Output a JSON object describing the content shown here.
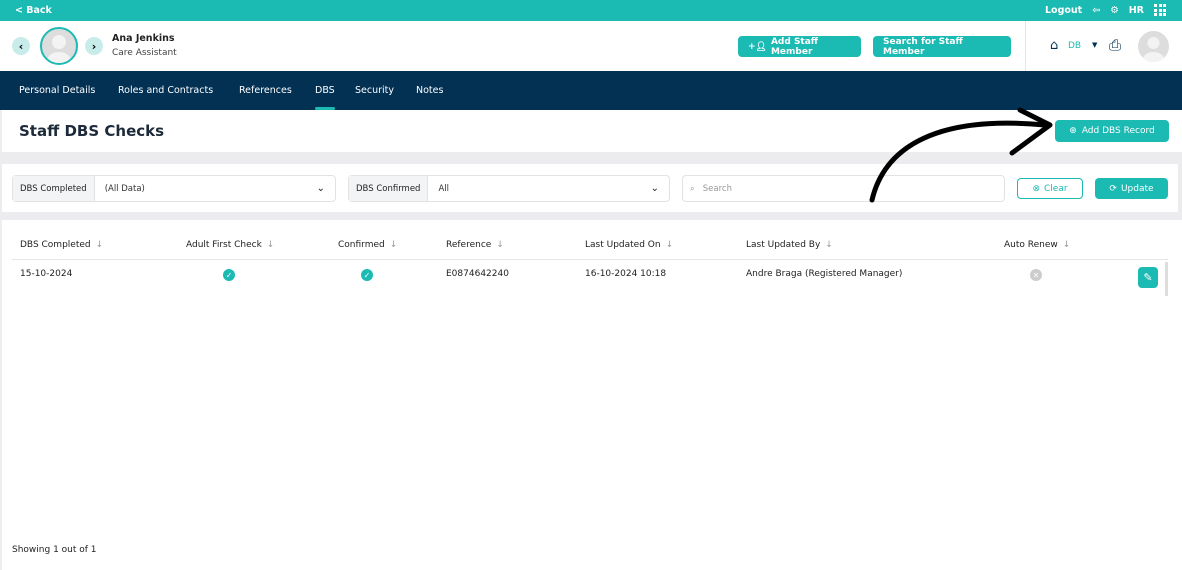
{
  "topbar": {
    "back": "< Back",
    "logout": "Logout",
    "initials": "HR"
  },
  "staff": {
    "name": "Ana Jenkins",
    "role": "Care Assistant"
  },
  "header": {
    "add_staff": "Add Staff Member",
    "search_staff": "Search for Staff Member",
    "home_label": "DB"
  },
  "nav": {
    "tabs": [
      "Personal Details",
      "Roles and Contracts",
      "References",
      "DBS",
      "Security",
      "Notes"
    ],
    "active": "DBS"
  },
  "page": {
    "title": "Staff DBS Checks",
    "add_button": "Add DBS Record"
  },
  "filters": {
    "dbs_completed_label": "DBS Completed",
    "dbs_completed_value": "(All Data)",
    "dbs_confirmed_label": "DBS Confirmed",
    "dbs_confirmed_value": "All",
    "search_placeholder": "Search",
    "clear": "Clear",
    "update": "Update"
  },
  "table": {
    "columns": [
      "DBS Completed",
      "Adult First Check",
      "Confirmed",
      "Reference",
      "Last Updated On",
      "Last Updated By",
      "Auto Renew"
    ],
    "rows": [
      {
        "dbs_completed": "15-10-2024",
        "adult_first_check": true,
        "confirmed": true,
        "reference": "E0874642240",
        "last_updated_on": "16-10-2024 10:18",
        "last_updated_by": "Andre Braga (Registered Manager)",
        "auto_renew": false
      }
    ]
  },
  "footer": {
    "showing": "Showing 1 out of 1"
  },
  "colors": {
    "teal": "#1bbab3",
    "navy": "#023154"
  }
}
